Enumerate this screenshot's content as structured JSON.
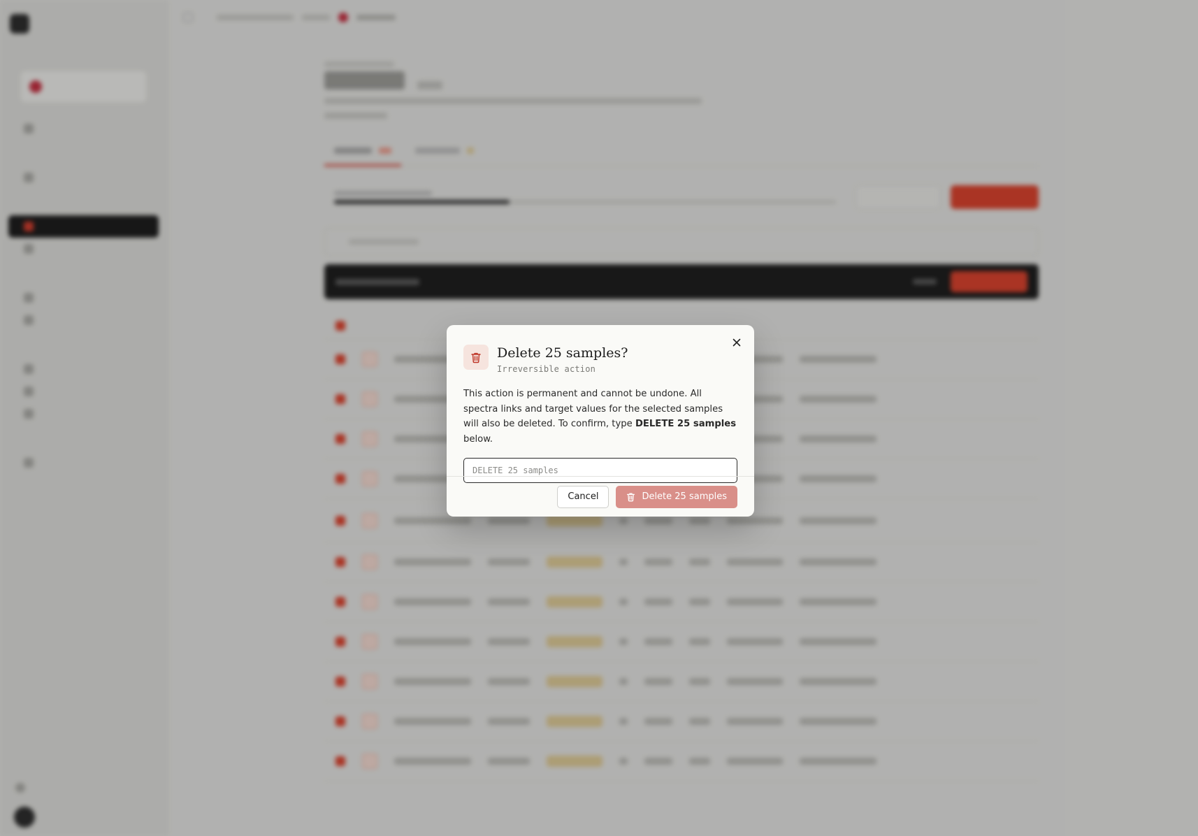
{
  "colors": {
    "accent": "#c0392b",
    "danger_disabled": "#d98f89",
    "icon_bg": "#f6e4de",
    "icon_stroke": "#c0392b"
  },
  "modal": {
    "icon": "trash-icon",
    "title": "Delete 25 samples?",
    "subtitle": "Irreversible action",
    "body_prefix": "This action is permanent and cannot be undone. All spectra links and target values for the selected samples will also be deleted. To confirm, type ",
    "confirm_phrase": "DELETE 25 samples",
    "body_suffix": " below.",
    "input_value": "",
    "input_placeholder": "DELETE 25 samples",
    "close_icon": "close-icon",
    "cancel_label": "Cancel",
    "delete_label": "Delete 25 samples",
    "delete_icon": "trash-icon"
  }
}
